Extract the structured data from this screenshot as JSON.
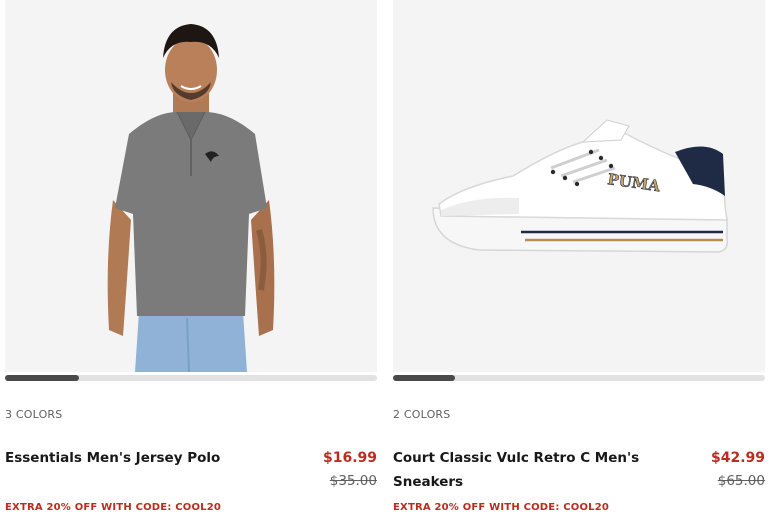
{
  "products": [
    {
      "colors_label": "3 COLORS",
      "name": "Essentials Men's Jersey Polo",
      "sale_price": "$16.99",
      "original_price": "$35.00",
      "promo": "EXTRA 20% OFF WITH CODE: COOL20",
      "carousel_progress": 0.2,
      "image": "product-photo-polo"
    },
    {
      "colors_label": "2 COLORS",
      "name": "Court Classic Vulc Retro C Men's Sneakers",
      "sale_price": "$42.99",
      "original_price": "$65.00",
      "promo": "EXTRA 20% OFF WITH CODE: COOL20",
      "carousel_progress": 0.17,
      "image": "product-photo-sneaker",
      "brand_text": "PUMA"
    }
  ],
  "colors": {
    "sale": "#ba2b20",
    "text": "#181818",
    "muted": "#5f5f5f",
    "image_bg": "#f4f4f4"
  }
}
